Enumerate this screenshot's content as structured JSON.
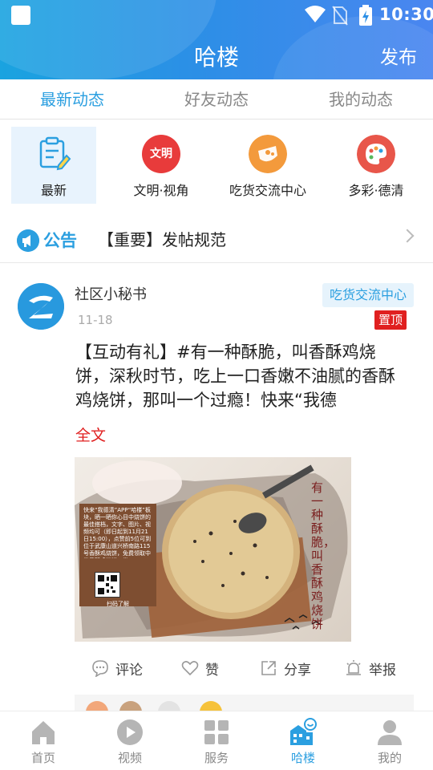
{
  "status_bar": {
    "time": "10:30"
  },
  "app_bar": {
    "title": "哈楼",
    "publish_label": "发布"
  },
  "tabs": [
    {
      "label": "最新动态",
      "active": true
    },
    {
      "label": "好友动态",
      "active": false
    },
    {
      "label": "我的动态",
      "active": false
    }
  ],
  "categories": [
    {
      "label": "最新",
      "icon": "clipboard-icon",
      "active": true
    },
    {
      "label": "文明·视角",
      "icon": "wenming-icon",
      "badge_text": "文明",
      "color": "#e83b3b"
    },
    {
      "label": "吃货交流中心",
      "icon": "food-icon",
      "color": "#f39a3c"
    },
    {
      "label": "多彩·德清",
      "icon": "palette-icon",
      "color": "#e8564a"
    }
  ],
  "announcement": {
    "badge_label": "公告",
    "text": "【重要】发帖规范"
  },
  "post": {
    "author": "社区小秘书",
    "date": "11-18",
    "topic": "吃货交流中心",
    "pinned_label": "置顶",
    "body": "【互动有礼】#有一种酥脆，叫香酥鸡烧饼，深秋时节，吃上一口香嫩不油腻的香酥鸡烧饼，那叫一个过瘾！快来“我德",
    "full_text_label": "全文",
    "image": {
      "vertical_title": "有一种酥脆，叫香酥鸡烧饼",
      "card_text": "快来“我德清”APP“哈楼”板块，晒一晒你心目中烧饼的最佳搭档，文字、图片、视频均可（即日起到11月21日15:00），点赞前5位可到位于武康山道兴桥南路115号香酥鸡烧饼，免费领取中份香酥鸡烧饼一份。",
      "qr_caption": "扫码了解"
    },
    "actions": [
      {
        "label": "评论",
        "icon": "comment-icon"
      },
      {
        "label": "赞",
        "icon": "heart-icon"
      },
      {
        "label": "分享",
        "icon": "share-icon"
      },
      {
        "label": "举报",
        "icon": "report-icon"
      }
    ]
  },
  "bottom_nav": [
    {
      "label": "首页",
      "icon": "home-icon",
      "active": false
    },
    {
      "label": "视频",
      "icon": "video-icon",
      "active": false
    },
    {
      "label": "服务",
      "icon": "grid-icon",
      "active": false
    },
    {
      "label": "哈楼",
      "icon": "halou-icon",
      "active": true
    },
    {
      "label": "我的",
      "icon": "profile-icon",
      "active": false
    }
  ],
  "colors": {
    "accent": "#2b9fe0",
    "red": "#e02020"
  }
}
